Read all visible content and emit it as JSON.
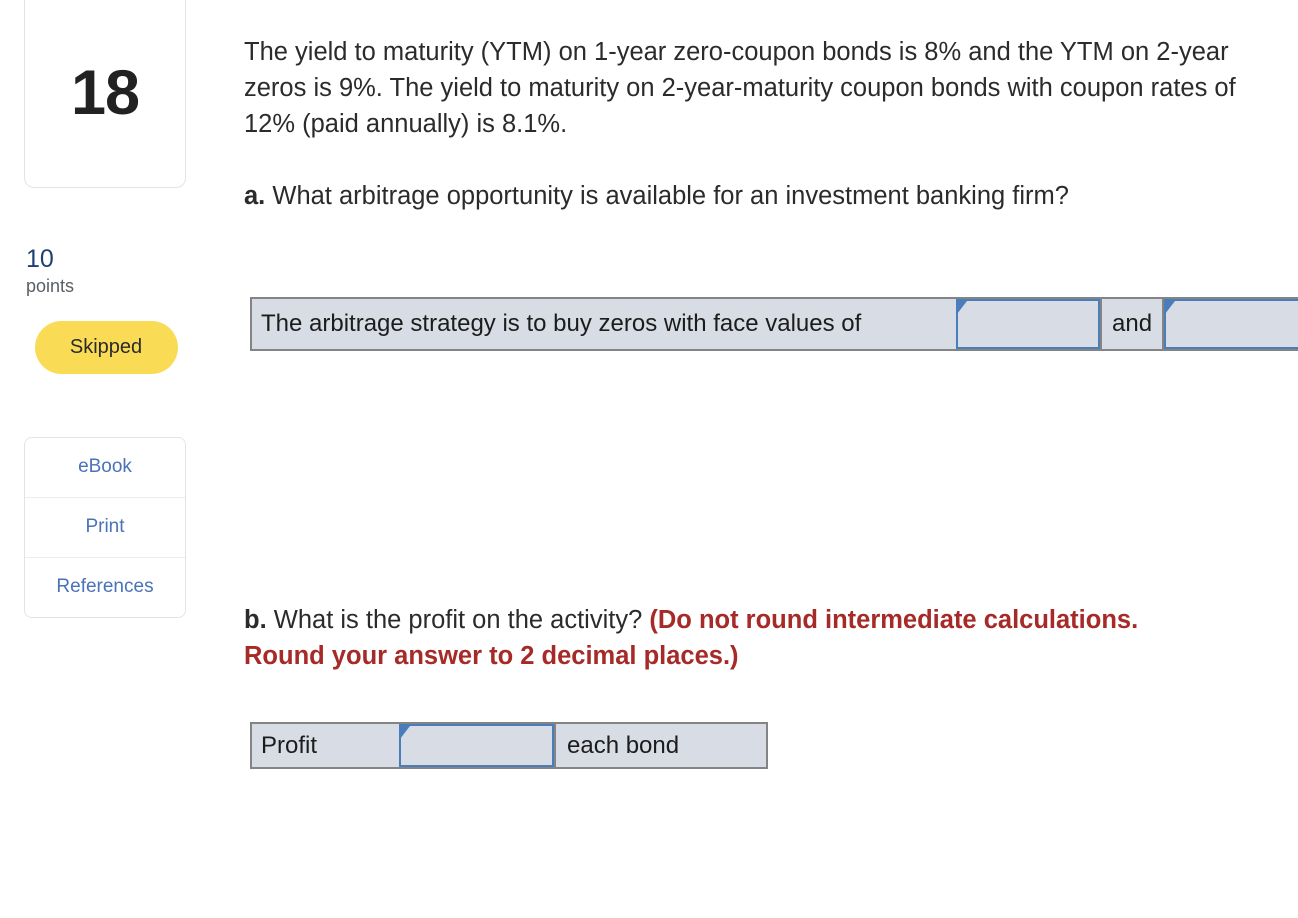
{
  "sidebar": {
    "question_number": "18",
    "points_value": "10",
    "points_label": "points",
    "status": "Skipped",
    "tools": [
      {
        "label": "eBook"
      },
      {
        "label": "Print"
      },
      {
        "label": "References"
      }
    ]
  },
  "question": {
    "stem": "The yield to maturity (YTM) on 1-year zero-coupon bonds is 8% and the YTM on 2-year zeros is 9%. The yield to maturity on 2-year-maturity coupon bonds with coupon rates of 12% (paid annually) is 8.1%.",
    "parts": [
      {
        "letter": "a.",
        "prompt": "What arbitrage opportunity is available for an investment banking firm?",
        "note": "",
        "answer_row": {
          "lead_text": "The arbitrage strategy is to buy zeros with face values of",
          "conjunction": "and",
          "input_1_value": "",
          "input_1_placeholder": "",
          "input_2_value": "",
          "input_2_placeholder": ""
        }
      },
      {
        "letter": "b.",
        "prompt": "What is the profit on the activity?",
        "note": "(Do not round intermediate calculations. Round your answer to 2 decimal places.)",
        "answer_row": {
          "lead_text": "Profit",
          "trailing_text": "each bond",
          "input_1_value": "",
          "input_1_placeholder": ""
        }
      }
    ]
  },
  "colors": {
    "badge_yellow": "#F9DB56",
    "link_blue": "#4A72B8",
    "points_blue": "#1F3F77",
    "note_red": "#A62A27",
    "input_border_blue": "#4A7EBB",
    "cell_bg": "#D7DCE5",
    "table_border": "#848484"
  }
}
